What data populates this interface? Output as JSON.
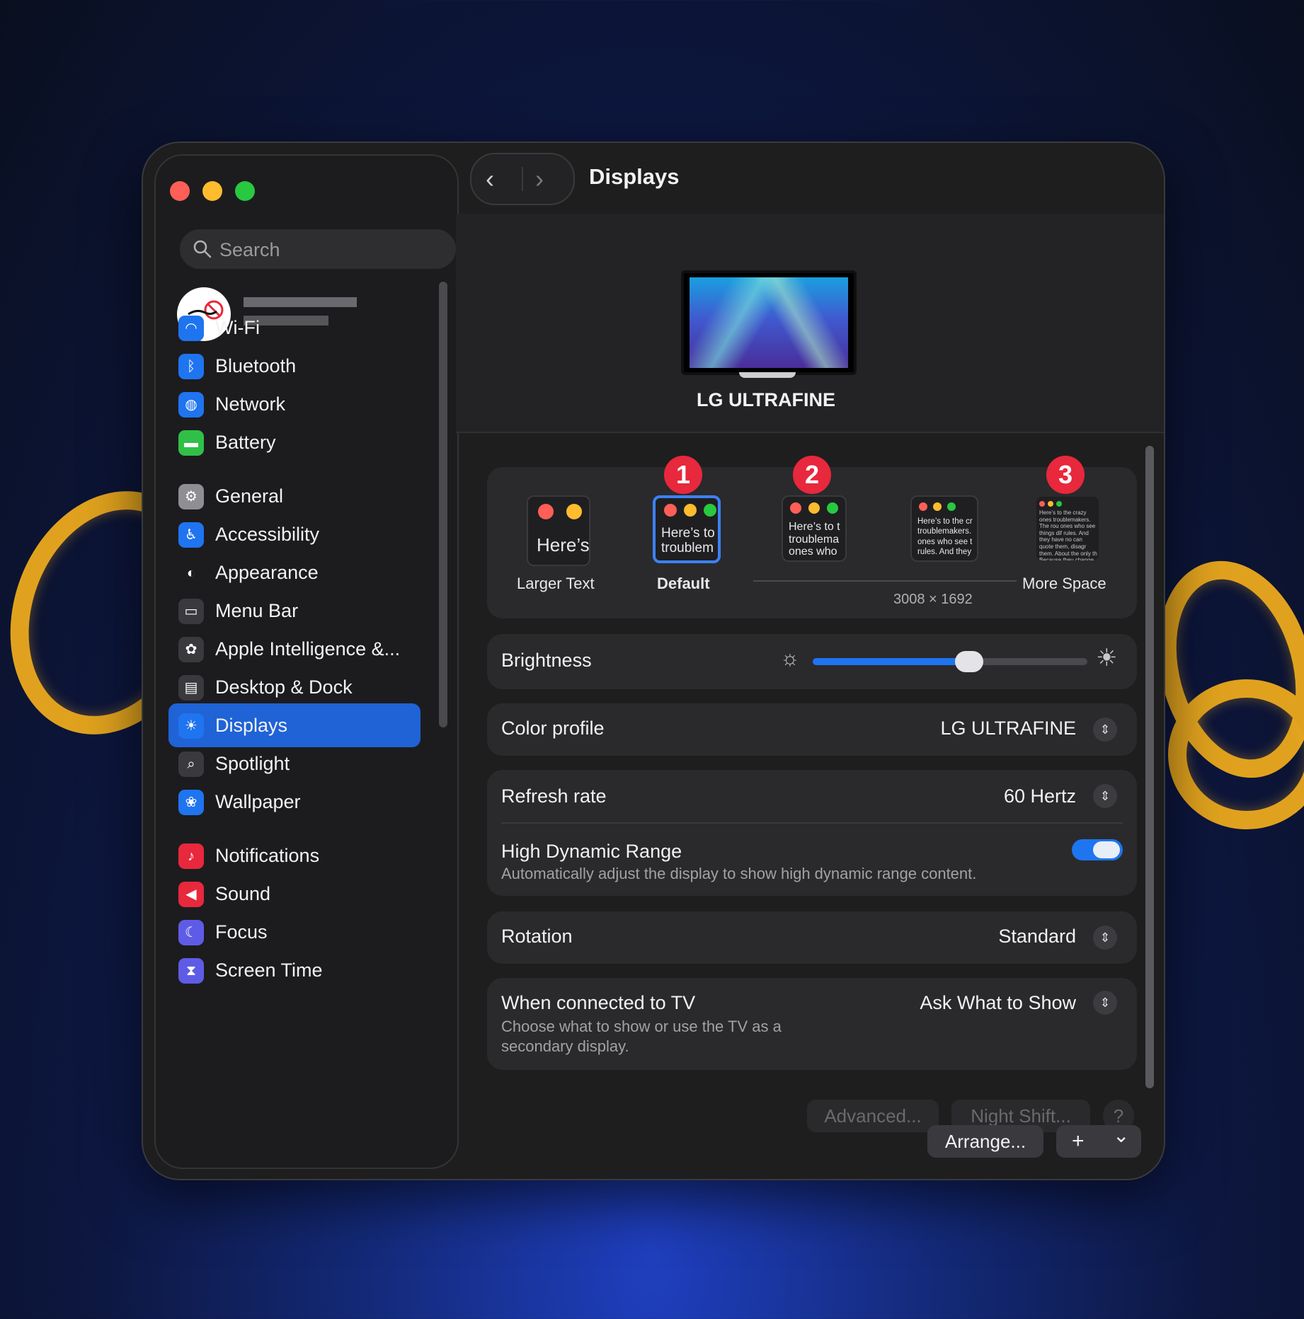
{
  "window": {
    "title": "Displays"
  },
  "sidebar": {
    "search_placeholder": "Search",
    "items": [
      {
        "label": "Wi-Fi",
        "icon": "wifi-icon",
        "color": "#1f74f0"
      },
      {
        "label": "Bluetooth",
        "icon": "bluetooth-icon",
        "color": "#1f74f0"
      },
      {
        "label": "Network",
        "icon": "globe-icon",
        "color": "#1f74f0"
      },
      {
        "label": "Battery",
        "icon": "battery-icon",
        "color": "#30c048"
      },
      {
        "label": "General",
        "icon": "gear-icon",
        "color": "#8e8e93"
      },
      {
        "label": "Accessibility",
        "icon": "accessibility-icon",
        "color": "#1f74f0"
      },
      {
        "label": "Appearance",
        "icon": "appearance-icon",
        "color": "#1c1c1e"
      },
      {
        "label": "Menu Bar",
        "icon": "menu-bar-icon",
        "color": "#3a3a3e"
      },
      {
        "label": "Apple Intelligence &...",
        "icon": "apple-intelligence-icon",
        "color": "#3a3a3e"
      },
      {
        "label": "Desktop & Dock",
        "icon": "dock-icon",
        "color": "#3a3a3e"
      },
      {
        "label": "Displays",
        "icon": "sun-icon",
        "color": "#1f74f0"
      },
      {
        "label": "Spotlight",
        "icon": "magnifier-icon",
        "color": "#3a3a3e"
      },
      {
        "label": "Wallpaper",
        "icon": "flower-icon",
        "color": "#1f74f0"
      },
      {
        "label": "Notifications",
        "icon": "bell-icon",
        "color": "#e8283c"
      },
      {
        "label": "Sound",
        "icon": "speaker-icon",
        "color": "#e8283c"
      },
      {
        "label": "Focus",
        "icon": "moon-icon",
        "color": "#5e5ce6"
      },
      {
        "label": "Screen Time",
        "icon": "hourglass-icon",
        "color": "#5e5ce6"
      }
    ],
    "selected": "Displays"
  },
  "display": {
    "name": "LG ULTRAFINE"
  },
  "resolution": {
    "options": [
      {
        "label": "Larger Text",
        "preview": "Here’s"
      },
      {
        "label": "Default",
        "preview": "Here’s to troublem"
      },
      {
        "label": "",
        "preview": "Here’s to t troublema ones who"
      },
      {
        "label": "",
        "preview": "Here’s to the cr troublemakers. ones who see t rules. And they"
      },
      {
        "label": "More Space",
        "preview": "Here’s to the crazy ones troublemakers. The rou ones who see things dif rules. And they have no can quote them, disagr them. About the only th Because they change th"
      }
    ],
    "badges": [
      "1",
      "2",
      "3"
    ],
    "resolution_text": "3008 × 1692"
  },
  "brightness": {
    "label": "Brightness",
    "level": 0.57
  },
  "color_profile": {
    "label": "Color profile",
    "value": "LG ULTRAFINE"
  },
  "refresh_rate": {
    "label": "Refresh rate",
    "value": "60 Hertz"
  },
  "hdr": {
    "label": "High Dynamic Range",
    "description": "Automatically adjust the display to show high dynamic range content.",
    "enabled": true
  },
  "rotation": {
    "label": "Rotation",
    "value": "Standard"
  },
  "tv": {
    "label": "When connected to TV",
    "description_1": "Choose what to show or use the TV as a",
    "description_2": "secondary display.",
    "value": "Ask What to Show"
  },
  "footer": {
    "advanced": "Advanced...",
    "night_shift": "Night Shift...",
    "help": "?",
    "arrange": "Arrange...",
    "add": "+",
    "more": "⌄"
  },
  "colors": {
    "accent": "#1f63d6",
    "badge": "#e8283c",
    "close": "#ff5f57",
    "minimize": "#febc2e",
    "zoom": "#28c840"
  }
}
